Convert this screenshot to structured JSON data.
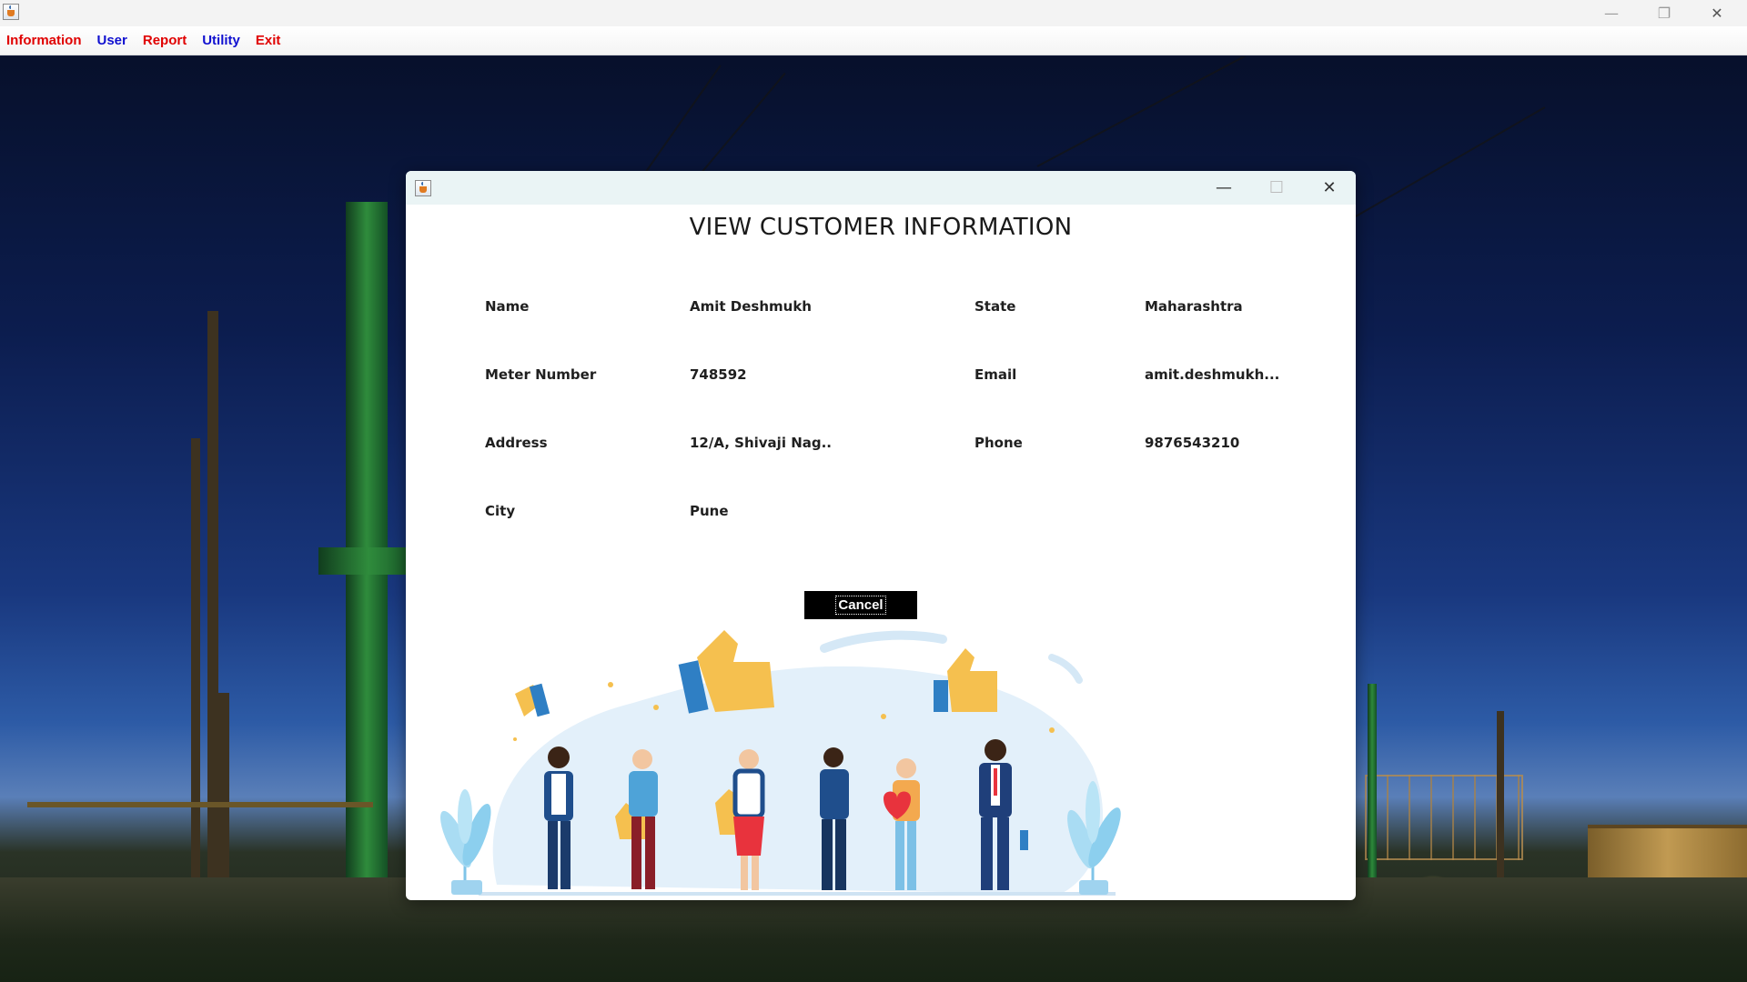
{
  "main_window": {
    "controls": {
      "minimize": "—",
      "maximize": "❐",
      "close": "✕"
    }
  },
  "menu": {
    "items": [
      {
        "label": "Information",
        "color": "#e00000"
      },
      {
        "label": "User",
        "color": "#1010d0"
      },
      {
        "label": "Report",
        "color": "#e00000"
      },
      {
        "label": "Utility",
        "color": "#1010d0"
      },
      {
        "label": "Exit",
        "color": "#e00000"
      }
    ]
  },
  "dialog": {
    "controls": {
      "minimize": "—",
      "maximize": "☐",
      "close": "✕"
    },
    "heading": "VIEW CUSTOMER INFORMATION",
    "fields": {
      "name": {
        "label": "Name",
        "value": "Amit Deshmukh"
      },
      "meter": {
        "label": "Meter Number",
        "value": "748592"
      },
      "address": {
        "label": "Address",
        "value": "12/A, Shivaji Nag.."
      },
      "city": {
        "label": "City",
        "value": "Pune"
      },
      "state": {
        "label": "State",
        "value": "Maharashtra"
      },
      "email": {
        "label": "Email",
        "value": "amit.deshmukh..."
      },
      "phone": {
        "label": "Phone",
        "value": "9876543210"
      }
    },
    "cancel_label": "Cancel"
  },
  "icons": {
    "app": "java-app-icon",
    "illustration": "thumbs-up-people-illustration"
  }
}
